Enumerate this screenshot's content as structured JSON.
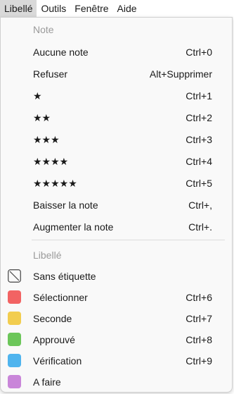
{
  "menubar": {
    "items": [
      {
        "label": "Libellé",
        "active": true
      },
      {
        "label": "Outils",
        "active": false
      },
      {
        "label": "Fenêtre",
        "active": false
      },
      {
        "label": "Aide",
        "active": false
      }
    ]
  },
  "menu": {
    "note_header": "Note",
    "note_items": [
      {
        "label": "Aucune note",
        "shortcut": "Ctrl+0"
      },
      {
        "label": "Refuser",
        "shortcut": "Alt+Supprimer"
      },
      {
        "label": "★",
        "shortcut": "Ctrl+1"
      },
      {
        "label": "★★",
        "shortcut": "Ctrl+2"
      },
      {
        "label": "★★★",
        "shortcut": "Ctrl+3"
      },
      {
        "label": "★★★★",
        "shortcut": "Ctrl+4"
      },
      {
        "label": "★★★★★",
        "shortcut": "Ctrl+5"
      },
      {
        "label": "Baisser la note",
        "shortcut": "Ctrl+,"
      },
      {
        "label": "Augmenter la note",
        "shortcut": "Ctrl+."
      }
    ],
    "label_header": "Libellé",
    "label_items": [
      {
        "label": "Sans étiquette",
        "shortcut": "",
        "color": "",
        "icon": "no-label-icon"
      },
      {
        "label": "Sélectionner",
        "shortcut": "Ctrl+6",
        "color": "#f26363",
        "icon": "red-swatch-icon"
      },
      {
        "label": "Seconde",
        "shortcut": "Ctrl+7",
        "color": "#f2cd4f",
        "icon": "yellow-swatch-icon"
      },
      {
        "label": "Approuvé",
        "shortcut": "Ctrl+8",
        "color": "#6cc65a",
        "icon": "green-swatch-icon"
      },
      {
        "label": "Vérification",
        "shortcut": "Ctrl+9",
        "color": "#4fb4ee",
        "icon": "blue-swatch-icon"
      },
      {
        "label": "A faire",
        "shortcut": "",
        "color": "#c986d9",
        "icon": "purple-swatch-icon"
      }
    ]
  }
}
